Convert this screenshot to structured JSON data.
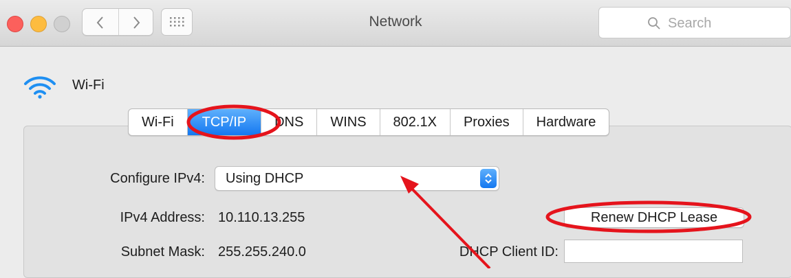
{
  "window": {
    "title": "Network",
    "search_placeholder": "Search"
  },
  "network": {
    "name": "Wi-Fi",
    "icon": "wifi-icon"
  },
  "tabs": [
    {
      "label": "Wi-Fi",
      "active": false
    },
    {
      "label": "TCP/IP",
      "active": true
    },
    {
      "label": "DNS",
      "active": false
    },
    {
      "label": "WINS",
      "active": false
    },
    {
      "label": "802.1X",
      "active": false
    },
    {
      "label": "Proxies",
      "active": false
    },
    {
      "label": "Hardware",
      "active": false
    }
  ],
  "form": {
    "configure_ipv4_label": "Configure IPv4:",
    "configure_ipv4_value": "Using DHCP",
    "ipv4_address_label": "IPv4 Address:",
    "ipv4_address_value": "10.110.13.255",
    "subnet_mask_label": "Subnet Mask:",
    "subnet_mask_value": "255.255.240.0",
    "renew_button_label": "Renew DHCP Lease",
    "dhcp_client_id_label": "DHCP Client ID:",
    "dhcp_client_id_value": ""
  },
  "colors": {
    "accent": "#1478f0",
    "annotation_red": "#e5141c",
    "close_light": "#fc605c",
    "minimize_light": "#fdbc40"
  }
}
